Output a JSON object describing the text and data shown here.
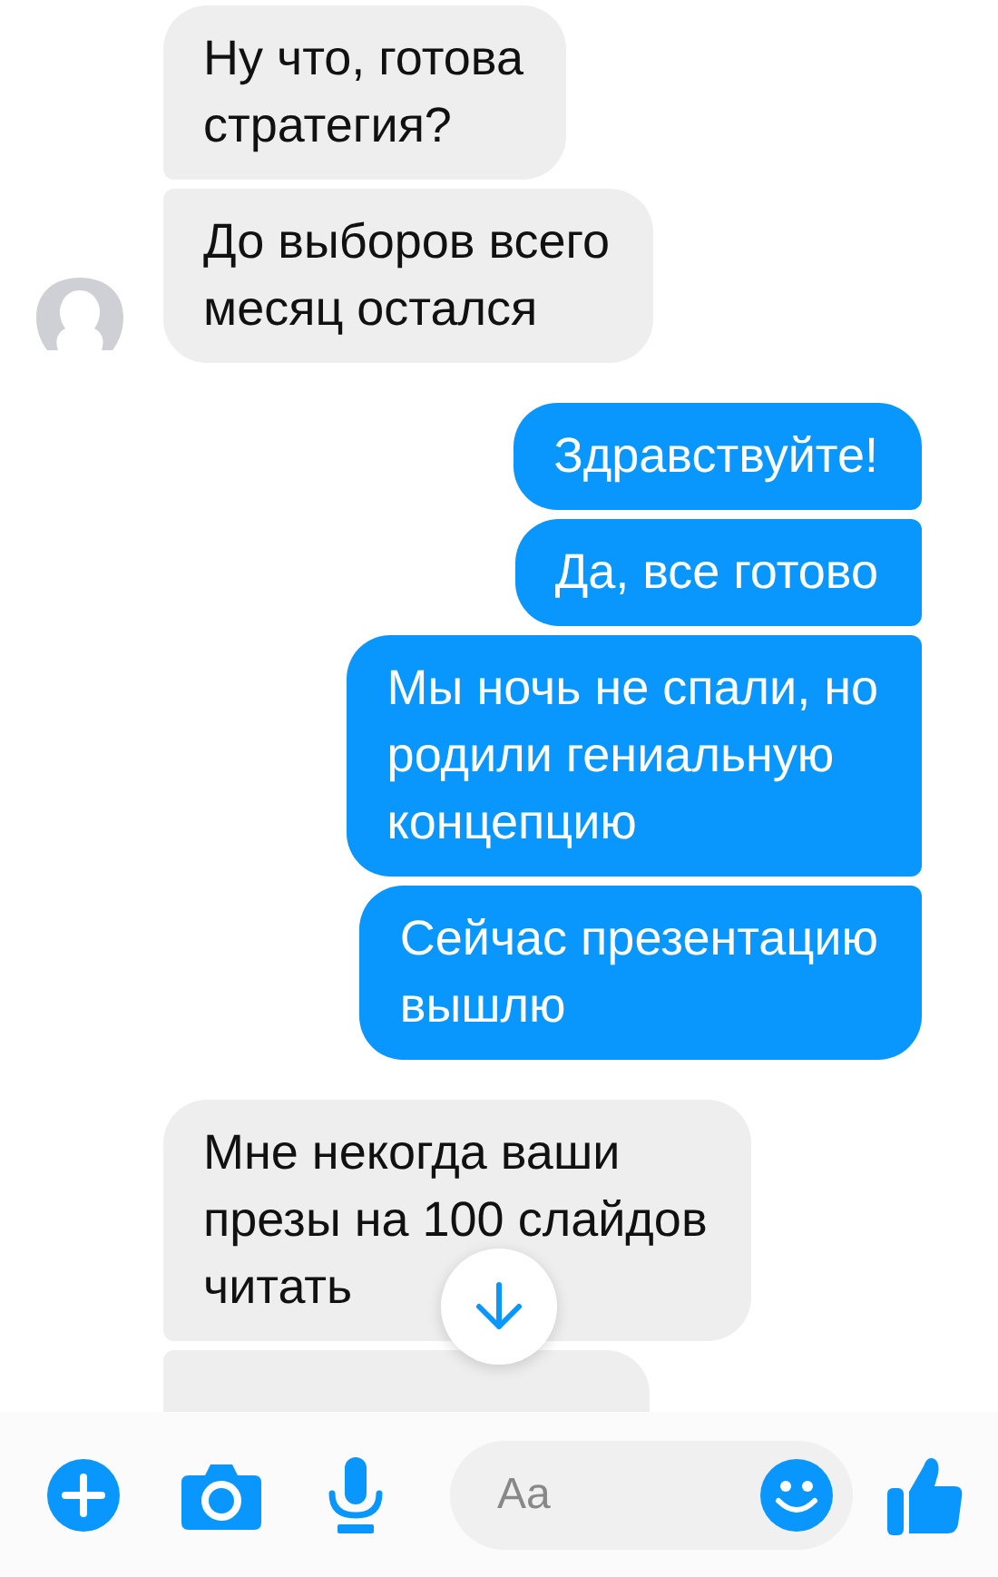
{
  "conversation": [
    {
      "outgoing": false,
      "avatar": true,
      "messages": [
        {
          "kind": "text",
          "text": "Ну что, готова\nстратегия?"
        },
        {
          "kind": "text",
          "text": "До выборов всего\nмесяц остался"
        }
      ]
    },
    {
      "outgoing": true,
      "avatar": false,
      "messages": [
        {
          "kind": "text",
          "text": "Здравствуйте!"
        },
        {
          "kind": "text",
          "text": "Да, все готово"
        },
        {
          "kind": "text",
          "text": "Мы ночь не спали, но\nродили гениальную\nконцепцию"
        },
        {
          "kind": "text",
          "text": "Сейчас презентацию\nвышлю"
        }
      ]
    },
    {
      "outgoing": false,
      "avatar": false,
      "messages": [
        {
          "kind": "text",
          "text": "Мне некогда ваши\nпрезы на 100 слайдов\nчитать"
        },
        {
          "kind": "cut_off"
        }
      ]
    }
  ],
  "composer": {
    "placeholder": "Aa"
  }
}
